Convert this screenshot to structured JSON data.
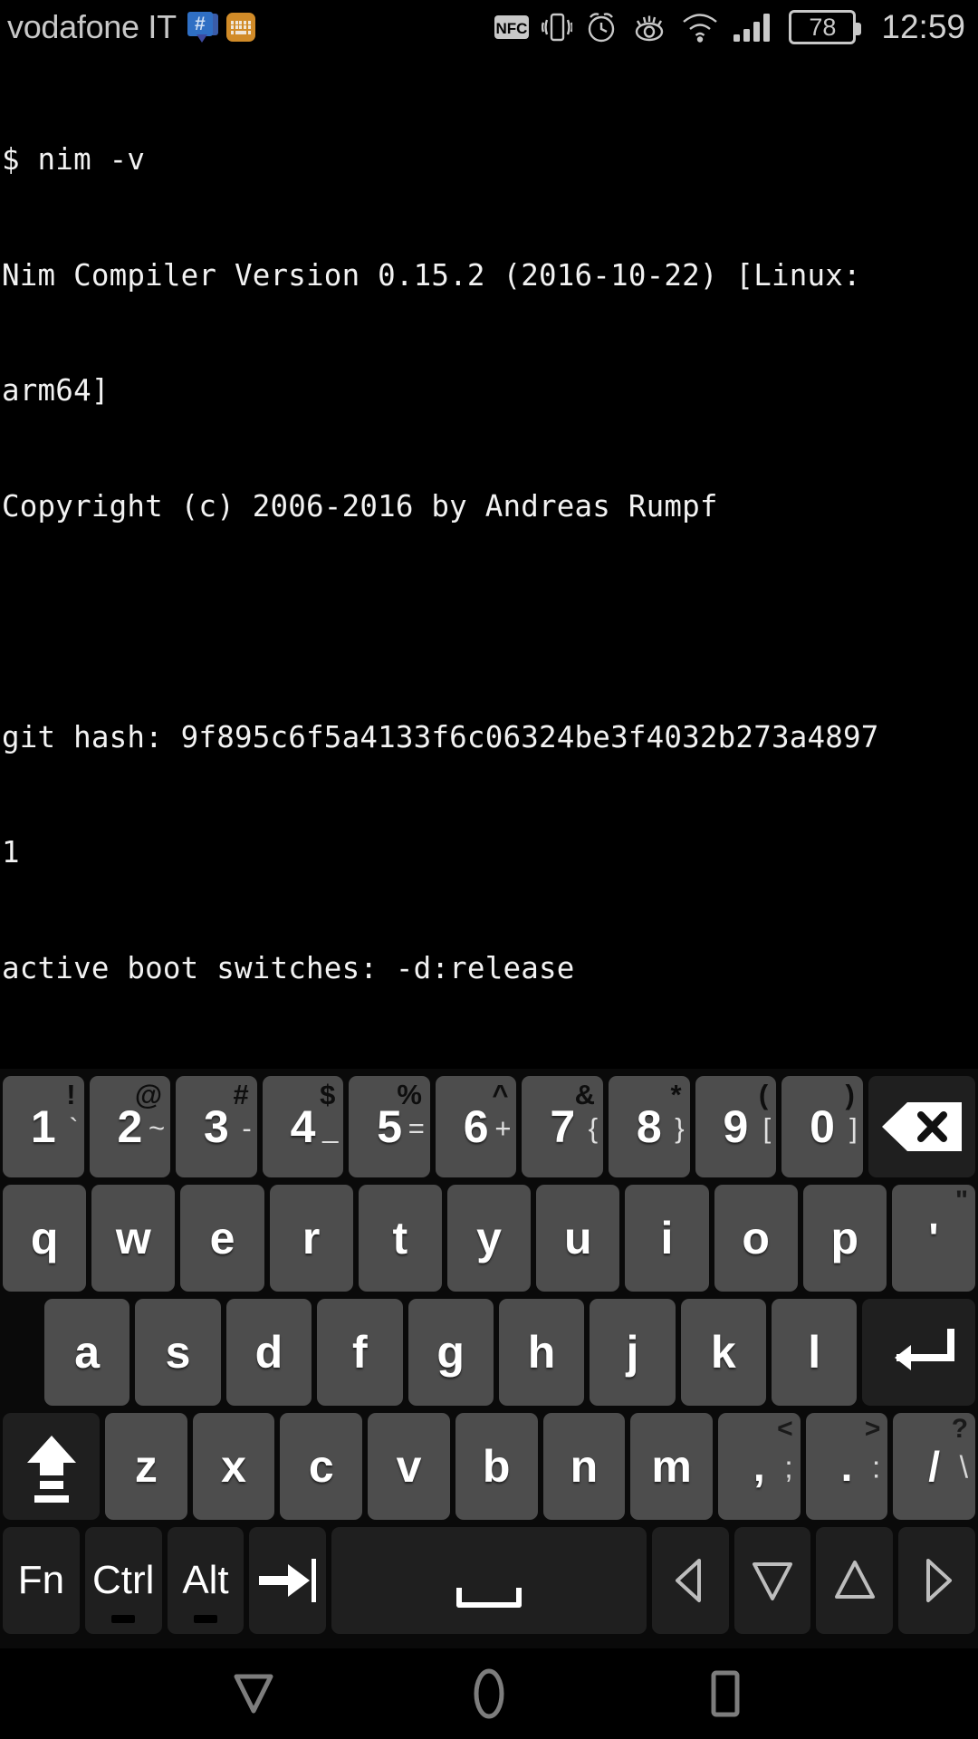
{
  "status_bar": {
    "carrier": "vodafone IT",
    "left_icons": [
      "hangouts-icon",
      "keyboard-app-icon"
    ],
    "right_icons": [
      "nfc-icon",
      "vibrate-icon",
      "alarm-icon",
      "eye-care-icon",
      "wifi-icon",
      "signal-icon"
    ],
    "nfc_label": "NFC",
    "battery_level": "78",
    "clock": "12:59"
  },
  "terminal": {
    "lines": [
      "$ nim -v",
      "Nim Compiler Version 0.15.2 (2016-10-22) [Linux:",
      "arm64]",
      "Copyright (c) 2006-2016 by Andreas Rumpf",
      "",
      "git hash: 9f895c6f5a4133f6c06324be3f4032b273a4897",
      "1",
      "active boot switches: -d:release"
    ],
    "prompt": "$ "
  },
  "keyboard": {
    "row1": [
      {
        "main": "1",
        "sup": "!",
        "mid": "`"
      },
      {
        "main": "2",
        "sup": "@",
        "mid": "~"
      },
      {
        "main": "3",
        "sup": "#",
        "mid": "-"
      },
      {
        "main": "4",
        "sup": "$",
        "mid": "_"
      },
      {
        "main": "5",
        "sup": "%",
        "mid": "="
      },
      {
        "main": "6",
        "sup": "^",
        "mid": "+"
      },
      {
        "main": "7",
        "sup": "&",
        "mid": "{"
      },
      {
        "main": "8",
        "sup": "*",
        "mid": "}"
      },
      {
        "main": "9",
        "sup": "(",
        "mid": "["
      },
      {
        "main": "0",
        "sup": ")",
        "mid": "]"
      }
    ],
    "backspace": "backspace-key",
    "row2": [
      {
        "main": "q"
      },
      {
        "main": "w"
      },
      {
        "main": "e"
      },
      {
        "main": "r"
      },
      {
        "main": "t"
      },
      {
        "main": "y"
      },
      {
        "main": "u"
      },
      {
        "main": "i"
      },
      {
        "main": "o"
      },
      {
        "main": "p"
      },
      {
        "main": "'",
        "sup": "\""
      }
    ],
    "row3": [
      {
        "main": "a"
      },
      {
        "main": "s"
      },
      {
        "main": "d"
      },
      {
        "main": "f"
      },
      {
        "main": "g"
      },
      {
        "main": "h"
      },
      {
        "main": "j"
      },
      {
        "main": "k"
      },
      {
        "main": "l"
      }
    ],
    "enter": "enter-key",
    "shift": "shift-key",
    "row4": [
      {
        "main": "z"
      },
      {
        "main": "x"
      },
      {
        "main": "c"
      },
      {
        "main": "v"
      },
      {
        "main": "b"
      },
      {
        "main": "n"
      },
      {
        "main": "m"
      },
      {
        "main": ",",
        "sup": "<",
        "mid": ";"
      },
      {
        "main": ".",
        "sup": ">",
        "mid": ":"
      },
      {
        "main": "/",
        "sup": "?",
        "mid": "\\"
      }
    ],
    "row5": {
      "fn": "Fn",
      "ctrl": "Ctrl",
      "alt": "Alt",
      "tab": "tab-key",
      "space": "space-key",
      "arrow_left": "arrow-left-key",
      "arrow_down": "arrow-down-key",
      "arrow_up": "arrow-up-key",
      "arrow_right": "arrow-right-key"
    }
  },
  "nav_bar": {
    "back": "back-button",
    "home": "home-button",
    "recents": "recents-button"
  },
  "colors": {
    "background": "#000000",
    "terminal_text": "#f2f2f2",
    "key_face": "#4d4d4d",
    "key_dark": "#1f1f1f",
    "status_icon": "#c8c8c8"
  }
}
